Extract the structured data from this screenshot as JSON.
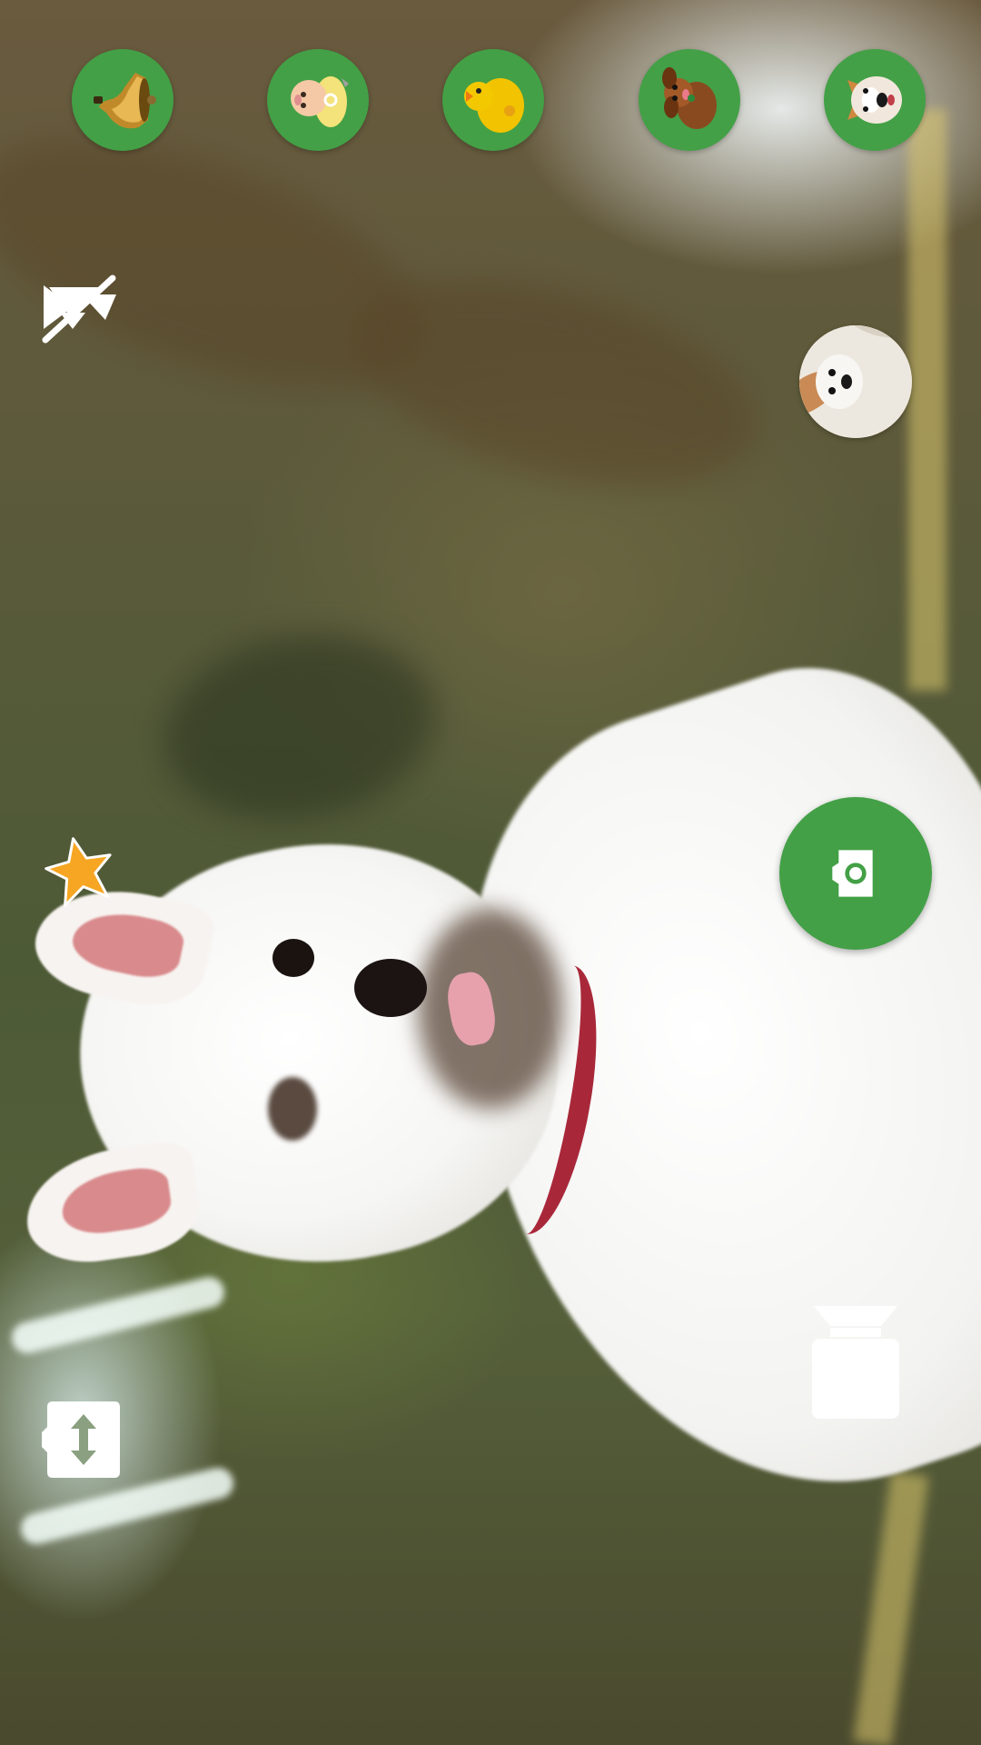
{
  "screen": {
    "type": "camera-viewfinder",
    "accent_color": "#43a046",
    "icon_color": "#ffffff"
  },
  "sound_bar": {
    "items": [
      {
        "id": "bell",
        "icon": "bell-icon"
      },
      {
        "id": "baby",
        "icon": "baby-icon"
      },
      {
        "id": "duck",
        "icon": "rubber-duck-icon"
      },
      {
        "id": "puppy",
        "icon": "puppy-icon"
      },
      {
        "id": "corgi",
        "icon": "corgi-face-icon"
      }
    ]
  },
  "controls": {
    "mute": {
      "icon": "volume-off-icon",
      "state": "muted"
    },
    "favorite": {
      "icon": "star-icon"
    },
    "last_photo": {
      "icon": "dog-photo-thumbnail"
    },
    "shutter": {
      "icon": "camera-icon"
    },
    "flash": {
      "icon": "flash-icon"
    },
    "switch_camera": {
      "icon": "switch-camera-icon"
    }
  }
}
